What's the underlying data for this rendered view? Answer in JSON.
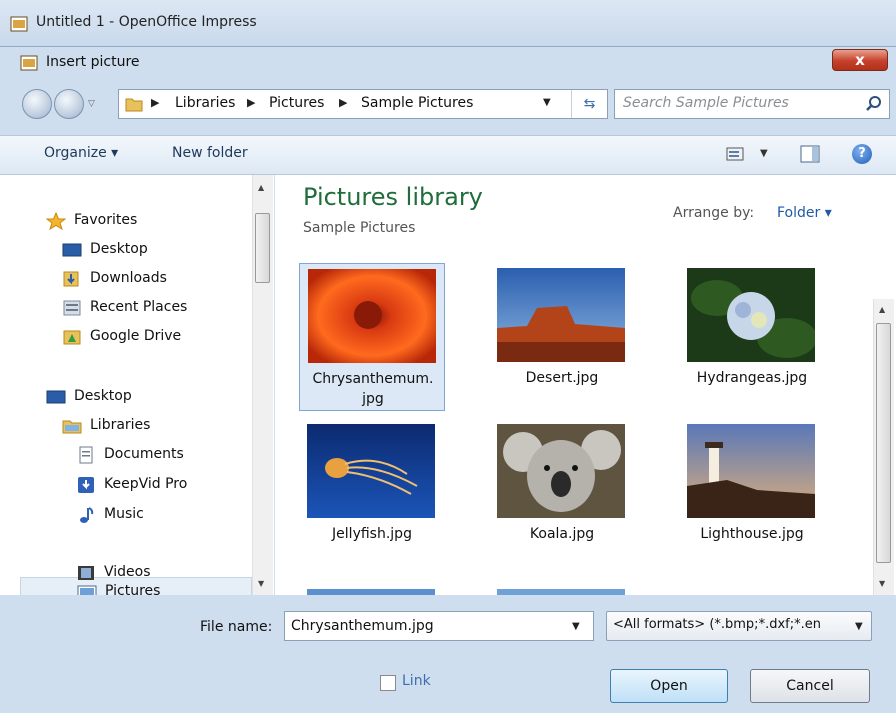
{
  "app": {
    "title": "Untitled 1 - OpenOffice Impress"
  },
  "dialog": {
    "title": "Insert picture",
    "close_label": "x"
  },
  "address": {
    "crumbs": [
      "Libraries",
      "Pictures",
      "Sample Pictures"
    ],
    "search_placeholder": "Search Sample Pictures"
  },
  "toolbar": {
    "organize": "Organize ▾",
    "new_folder": "New folder",
    "help": "?"
  },
  "nav": {
    "items": [
      {
        "label": "Favorites",
        "icon": "star-icon"
      },
      {
        "label": "Desktop",
        "icon": "desktop-icon"
      },
      {
        "label": "Downloads",
        "icon": "downloads-icon"
      },
      {
        "label": "Recent Places",
        "icon": "recent-places-icon"
      },
      {
        "label": "Google Drive",
        "icon": "google-drive-icon"
      },
      {
        "label": "Desktop",
        "icon": "desktop-icon"
      },
      {
        "label": "Libraries",
        "icon": "libraries-icon"
      },
      {
        "label": "Documents",
        "icon": "documents-icon"
      },
      {
        "label": "KeepVid Pro",
        "icon": "keepvid-icon"
      },
      {
        "label": "Music",
        "icon": "music-icon"
      },
      {
        "label": "Pictures",
        "icon": "pictures-icon",
        "selected": true
      },
      {
        "label": "Videos",
        "icon": "videos-icon"
      }
    ]
  },
  "content": {
    "title": "Pictures library",
    "subtitle": "Sample Pictures",
    "arrange_label": "Arrange by:",
    "arrange_value": "Folder ▾",
    "files": [
      {
        "name_line1": "Chrysanthemum.",
        "name_line2": "jpg",
        "selected": true
      },
      {
        "name_line1": "Desert.jpg",
        "name_line2": ""
      },
      {
        "name_line1": "Hydrangeas.jpg",
        "name_line2": ""
      },
      {
        "name_line1": "Jellyfish.jpg",
        "name_line2": ""
      },
      {
        "name_line1": "Koala.jpg",
        "name_line2": ""
      },
      {
        "name_line1": "Lighthouse.jpg",
        "name_line2": ""
      }
    ]
  },
  "bottom": {
    "file_name_label": "File name:",
    "file_name_value": "Chrysanthemum.jpg",
    "filter": "<All formats> (*.bmp;*.dxf;*.en",
    "link_label": "Link",
    "open": "Open",
    "cancel": "Cancel"
  },
  "colors": {
    "library_title": "#1e6d3a",
    "link_blue": "#1e5aa8",
    "close_red": "#c5412b"
  }
}
